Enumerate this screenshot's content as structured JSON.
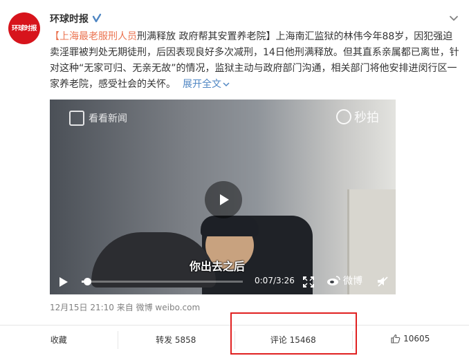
{
  "user": {
    "name": "环球时报",
    "avatar_text": "环球时报"
  },
  "post": {
    "content_segments": [
      {
        "text": "【上海最老",
        "style": "link"
      },
      {
        "text": "服刑人员",
        "style": "hl"
      },
      {
        "text": "刑满释放 政府帮其安置养老院】上海南汇监狱的林伟今年88岁，因犯强迫卖淫罪被判处无期徒刑，后因表现良好多次减刑，14日他刑满释放。但其直系亲属都已离世，针对这种“无家可归、无亲无故”的情况，监狱主动与政府部门沟通，相关部门将他安排进闵行区一家养老院，感受社会的关怀。",
        "style": "normal"
      }
    ],
    "expand_label": "展开全文",
    "meta_time": "12月15日 21:10",
    "meta_from": "来自",
    "meta_source": "微博 weibo.com"
  },
  "video": {
    "logo_left": "看看新闻",
    "logo_right": "秒拍",
    "subtitle": "你出去之后",
    "time": "0:07/3:26",
    "progress": 0.02,
    "weibo_label": "微博"
  },
  "actions": {
    "favorite": "收藏",
    "repost": "转发 5858",
    "comment": "评论 15468",
    "like": "10605"
  },
  "colors": {
    "brand_red": "#d7141c",
    "link_orange": "#eb7350",
    "expand_blue": "#4f86c3",
    "highlight_red": "#e02020"
  }
}
